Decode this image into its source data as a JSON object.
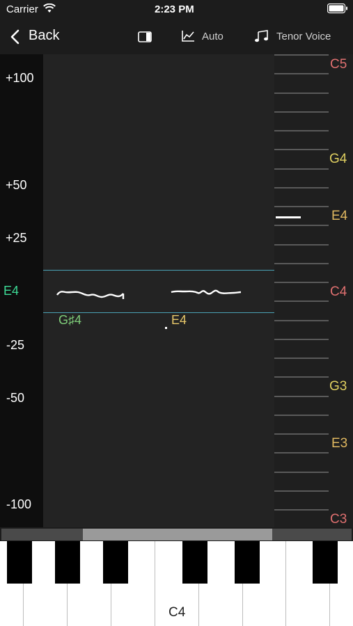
{
  "status_bar": {
    "carrier": "Carrier",
    "time": "2:23 PM"
  },
  "nav": {
    "back_label": "Back",
    "auto_label": "Auto",
    "voice_label": "Tenor Voice"
  },
  "cents_scale": {
    "labels": [
      "+100",
      "+50",
      "+25",
      "E4",
      "-25",
      "-50",
      "-100"
    ],
    "current_note_color": "#3ddc97"
  },
  "graph": {
    "detected_notes": [
      {
        "label": "G♯4",
        "color": "#7fce7a"
      },
      {
        "label": "E4",
        "color": "#e8c86a"
      }
    ],
    "tune_line_color": "#4aa3b5"
  },
  "note_scale": {
    "labels": [
      {
        "text": "C5",
        "color": "#e07070"
      },
      {
        "text": "G4",
        "color": "#e0d060"
      },
      {
        "text": "E4",
        "color": "#e0b860"
      },
      {
        "text": "C4",
        "color": "#e07070"
      },
      {
        "text": "G3",
        "color": "#e0d060"
      },
      {
        "text": "E3",
        "color": "#e0b860"
      },
      {
        "text": "C3",
        "color": "#e07070"
      }
    ],
    "current_pitch_marker": "E4"
  },
  "keyboard": {
    "c4_label": "C4"
  }
}
